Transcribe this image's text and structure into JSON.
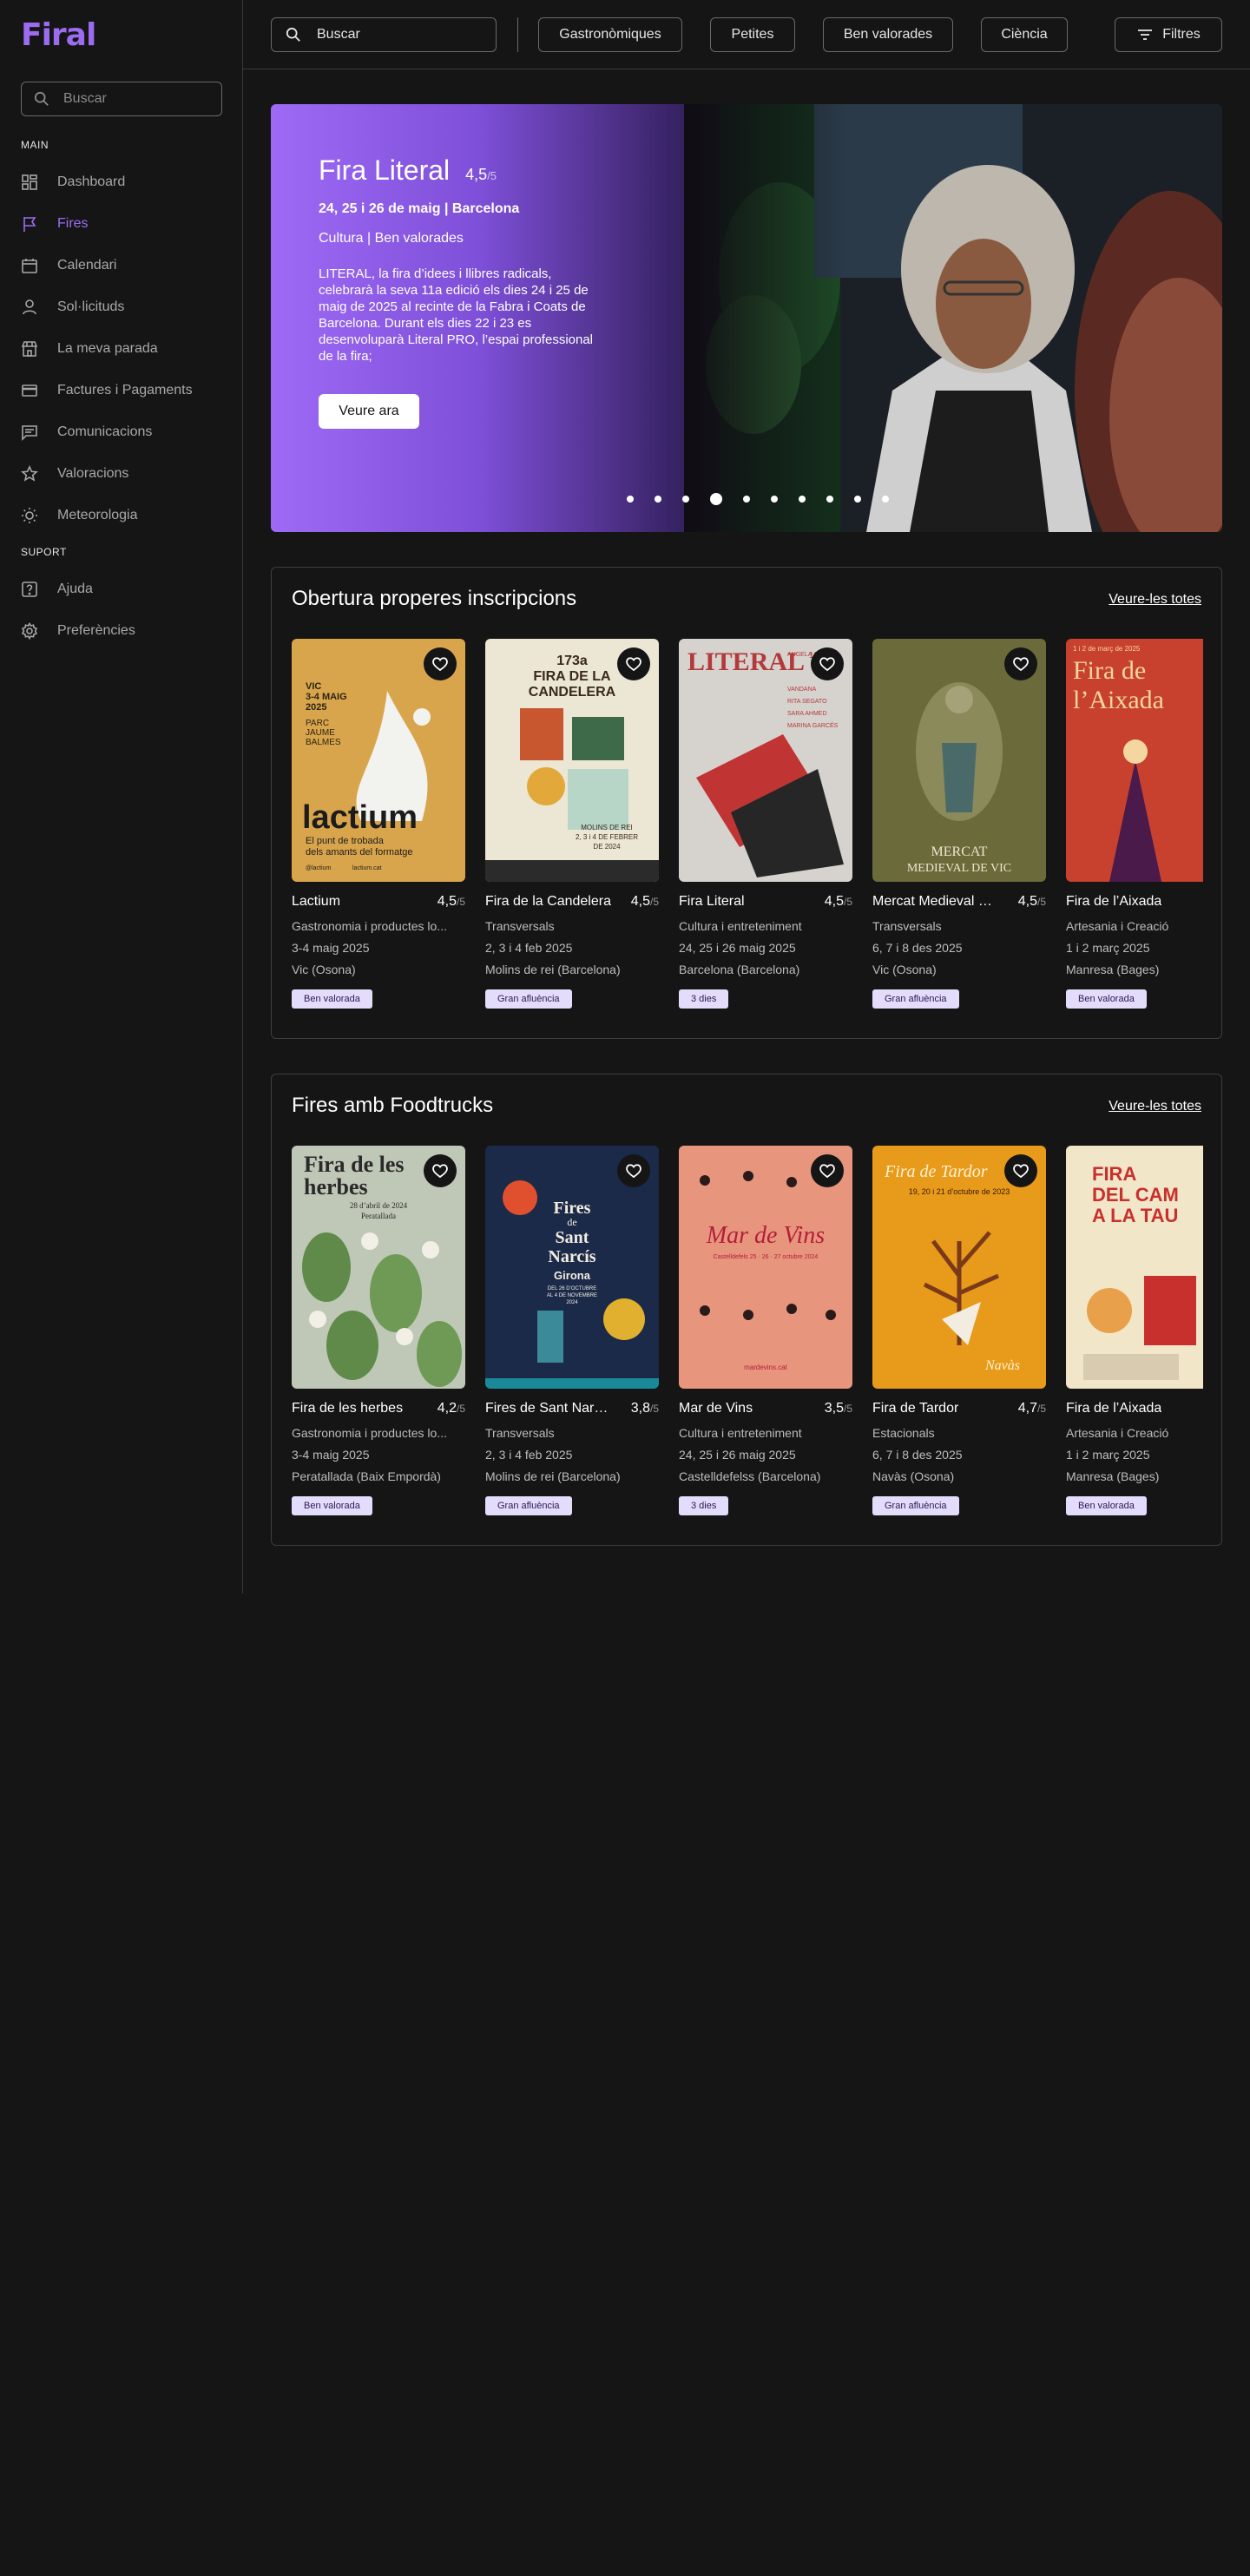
{
  "app": {
    "logo": "Firal"
  },
  "sidebar": {
    "search_placeholder": "Buscar",
    "main_label": "MAIN",
    "support_label": "SUPORT",
    "main_items": [
      {
        "label": "Dashboard",
        "icon": "dashboard-icon"
      },
      {
        "label": "Fires",
        "icon": "flag-icon",
        "active": true
      },
      {
        "label": "Calendari",
        "icon": "calendar-icon"
      },
      {
        "label": "Sol·licituds",
        "icon": "user-icon"
      },
      {
        "label": "La meva parada",
        "icon": "store-icon"
      },
      {
        "label": "Factures i Pagaments",
        "icon": "credit-card-icon"
      },
      {
        "label": "Comunicacions",
        "icon": "message-icon"
      },
      {
        "label": "Valoracions",
        "icon": "star-icon"
      },
      {
        "label": "Meteorologia",
        "icon": "sun-icon"
      }
    ],
    "support_items": [
      {
        "label": "Ajuda",
        "icon": "help-icon"
      },
      {
        "label": "Preferències",
        "icon": "settings-icon"
      }
    ]
  },
  "topbar": {
    "search_placeholder": "Buscar",
    "chips": [
      "Gastronòmiques",
      "Petites",
      "Ben valorades",
      "Ciència"
    ],
    "filters_label": "Filtres"
  },
  "hero": {
    "title": "Fira Literal",
    "rating": "4,5",
    "rating_den": "/5",
    "dates": "24, 25 i 26 de maig | Barcelona",
    "tags": "Cultura | Ben valorades",
    "description": "LITERAL, la fira d’idees i llibres radicals, celebrarà la seva 11a edició els dies 24 i 25 de maig de 2025 al recinte de la Fabra i Coats de Barcelona. Durant els dies 22 i 23 es desenvoluparà Literal PRO, l’espai professional de la fira;",
    "cta": "Veure ara",
    "slides": 10,
    "active_slide": 4
  },
  "sections": [
    {
      "title": "Obertura properes inscripcions",
      "see_all": "Veure-les totes",
      "cards": [
        {
          "name": "Lactium",
          "rating": "4,5",
          "den": "/5",
          "category": "Gastronomia i productes lo...",
          "dates": "3-4 maig 2025",
          "place": "Vic (Osona)",
          "badge": "Ben valorada",
          "poster_text": [
            "VIC",
            "3-4 MAIG",
            "2025",
            "PARC",
            "JAUME",
            "BALMES",
            "lactium",
            "El punt de trobada",
            "dels amants del formatge",
            "@lactium",
            "lactium.cat"
          ]
        },
        {
          "name": "Fira de la Candelera",
          "rating": "4,5",
          "den": "/5",
          "category": "Transversals",
          "dates": "2, 3 i 4 feb 2025",
          "place": "Molins de rei (Barcelona)",
          "badge": "Gran afluència",
          "poster_text": [
            "173a",
            "FIRA DE LA",
            "CANDELERA",
            "MOLINS DE REI",
            "2, 3 i 4 DE FEBRER",
            "DE 2024"
          ]
        },
        {
          "name": "Fira Literal",
          "rating": "4,5",
          "den": "/5",
          "category": "Cultura i entreteniment",
          "dates": "24, 25 i 26 maig 2025",
          "place": "Barcelona (Barcelona)",
          "badge": "3 dies",
          "poster_text": [
            "LITERAL",
            "10",
            "ANGELA",
            "VANDANA",
            "RITA SEGATO",
            "SARA AHMED",
            "MARINA GARCÉS"
          ]
        },
        {
          "name": "Mercat Medieval de Vic",
          "rating": "4,5",
          "den": "/5",
          "category": "Transversals",
          "dates": "6, 7 i 8 des 2025",
          "place": "Vic (Osona)",
          "badge": "Gran afluència",
          "poster_text": [
            "MERCAT",
            "MEDIEVAL DE VIC"
          ]
        },
        {
          "name": "Fira de l’Aixada",
          "rating": "",
          "den": "",
          "category": "Artesania i Creació",
          "dates": "1 i 2 març 2025",
          "place": "Manresa (Bages)",
          "badge": "Ben valorada",
          "poster_text": [
            "1 i 2 de març de 2025",
            "Fira de",
            "l’Aixada"
          ]
        }
      ]
    },
    {
      "title": "Fires amb Foodtrucks",
      "see_all": "Veure-les totes",
      "cards": [
        {
          "name": "Fira de les herbes",
          "rating": "4,2",
          "den": "/5",
          "category": "Gastronomia i productes lo...",
          "dates": "3-4 maig 2025",
          "place": "Peratallada (Baix Empordà)",
          "badge": "Ben valorada",
          "poster_text": [
            "Fira de les",
            "herbes",
            "28 d’abril de 2024",
            "Peratallada"
          ]
        },
        {
          "name": "Fires de Sant Narcís",
          "rating": "3,8",
          "den": "/5",
          "category": "Transversals",
          "dates": "2, 3 i 4 feb 2025",
          "place": "Molins de rei (Barcelona)",
          "badge": "Gran afluència",
          "poster_text": [
            "Fires",
            "de",
            "Sant",
            "Narcís",
            "Girona",
            "DEL 26 D’OCTUBRE",
            "AL 4 DE NOVEMBRE",
            "2024"
          ]
        },
        {
          "name": "Mar de Vins",
          "rating": "3,5",
          "den": "/5",
          "category": "Cultura i entreteniment",
          "dates": "24, 25 i 26 maig 2025",
          "place": "Castelldefelss (Barcelona)",
          "badge": "3 dies",
          "poster_text": [
            "Mar de Vins",
            "Castelldefels 25 · 26 · 27 octubre 2024",
            "mardevins.cat"
          ]
        },
        {
          "name": "Fira de Tardor",
          "rating": "4,7",
          "den": "/5",
          "category": "Estacionals",
          "dates": "6, 7 i 8 des 2025",
          "place": "Navàs (Osona)",
          "badge": "Gran afluència",
          "poster_text": [
            "Fira de Tardor",
            "19, 20 i 21 d’octubre de 2023",
            "Navàs"
          ]
        },
        {
          "name": "Fira de l’Aixada",
          "rating": "",
          "den": "",
          "category": "Artesania i Creació",
          "dates": "1 i 2 març 2025",
          "place": "Manresa (Bages)",
          "badge": "Ben valorada",
          "poster_text": [
            "FIRA",
            "DEL CAM",
            "A LA TAU"
          ]
        }
      ]
    }
  ],
  "colors": {
    "accent": "#9b6cf0",
    "background": "#151515",
    "badge_bg": "#e3dcfb"
  }
}
